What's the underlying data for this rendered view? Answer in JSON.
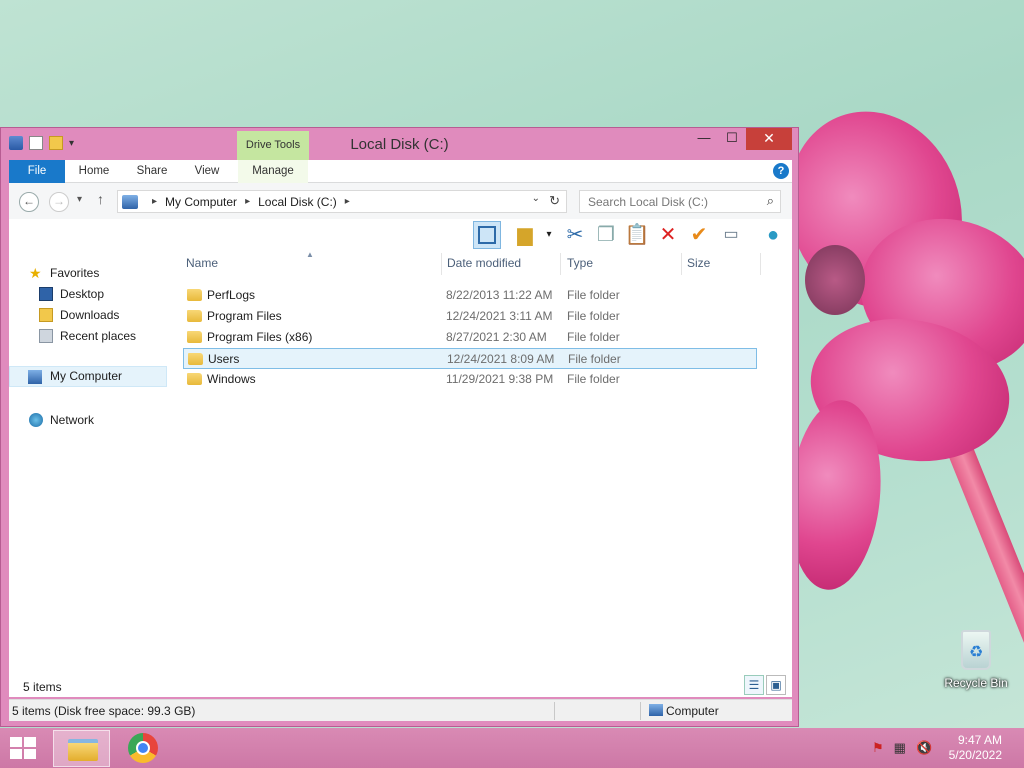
{
  "window": {
    "title": "Local Disk (C:)",
    "contextual_tab": "Drive Tools",
    "buttons": {
      "minimize": "—",
      "maximize": "☐",
      "close": "✕"
    }
  },
  "ribbon": {
    "tabs": [
      "File",
      "Home",
      "Share",
      "View",
      "Manage"
    ],
    "help": "?"
  },
  "address_bar": {
    "segments": [
      "My Computer",
      "Local Disk (C:)"
    ],
    "search_placeholder": "Search Local Disk (C:)"
  },
  "navigation_pane": {
    "favorites": "Favorites",
    "favorite_items": [
      "Desktop",
      "Downloads",
      "Recent places"
    ],
    "my_computer": "My Computer",
    "network": "Network"
  },
  "file_list": {
    "columns": [
      "Name",
      "Date modified",
      "Type",
      "Size"
    ],
    "rows": [
      {
        "name": "PerfLogs",
        "date": "8/22/2013 11:22 AM",
        "type": "File folder"
      },
      {
        "name": "Program Files",
        "date": "12/24/2021 3:11 AM",
        "type": "File folder"
      },
      {
        "name": "Program Files (x86)",
        "date": "8/27/2021 2:30 AM",
        "type": "File folder"
      },
      {
        "name": "Users",
        "date": "12/24/2021 8:09 AM",
        "type": "File folder",
        "selected": true
      },
      {
        "name": "Windows",
        "date": "11/29/2021 9:38 PM",
        "type": "File folder"
      }
    ]
  },
  "item_count": "5 items",
  "status_bar": {
    "left": "5 items (Disk free space: 99.3 GB)",
    "right": "Computer"
  },
  "desktop": {
    "recycle_bin": "Recycle Bin"
  },
  "taskbar": {
    "time": "9:47 AM",
    "date": "5/20/2022"
  },
  "colors": {
    "window_frame": "#e08bbd",
    "file_tab": "#1979ca",
    "drive_tools": "#c5e6a0",
    "close_button": "#c7403a",
    "selection": "#e5f3fb"
  }
}
